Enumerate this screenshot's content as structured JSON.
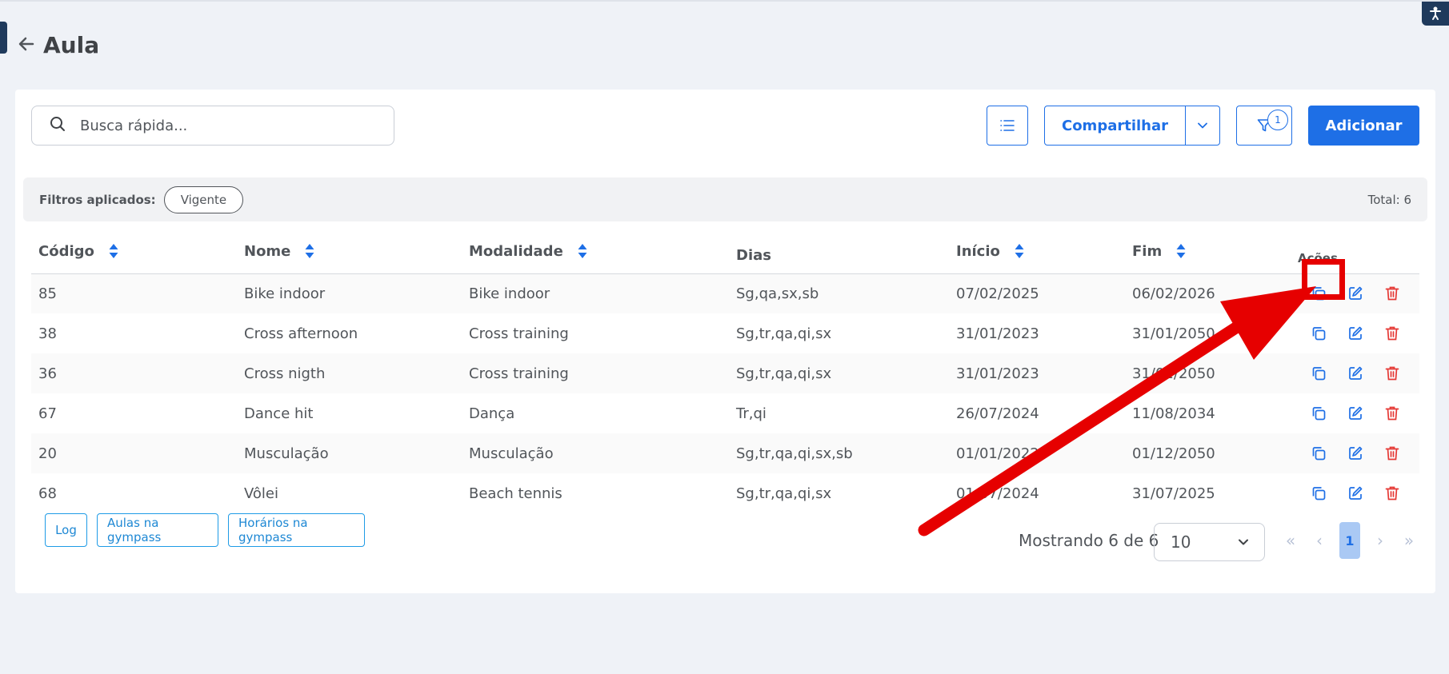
{
  "page": {
    "title": "Aula"
  },
  "search": {
    "placeholder": "Busca rápida..."
  },
  "toolbar": {
    "share_label": "Compartilhar",
    "filter_count": "1",
    "add_label": "Adicionar"
  },
  "filters": {
    "label": "Filtros aplicados:",
    "chip": "Vigente",
    "total": "Total: 6"
  },
  "table": {
    "headers": {
      "codigo": "Código",
      "nome": "Nome",
      "modalidade": "Modalidade",
      "dias": "Dias",
      "inicio": "Início",
      "fim": "Fim",
      "acoes": "Ações"
    },
    "rows": [
      {
        "codigo": "85",
        "nome": "Bike indoor",
        "modalidade": "Bike indoor",
        "dias": "Sg,qa,sx,sb",
        "inicio": "07/02/2025",
        "fim": "06/02/2026"
      },
      {
        "codigo": "38",
        "nome": "Cross afternoon",
        "modalidade": "Cross training",
        "dias": "Sg,tr,qa,qi,sx",
        "inicio": "31/01/2023",
        "fim": "31/01/2050"
      },
      {
        "codigo": "36",
        "nome": "Cross nigth",
        "modalidade": "Cross training",
        "dias": "Sg,tr,qa,qi,sx",
        "inicio": "31/01/2023",
        "fim": "31/01/2050"
      },
      {
        "codigo": "67",
        "nome": "Dance hit",
        "modalidade": "Dança",
        "dias": "Tr,qi",
        "inicio": "26/07/2024",
        "fim": "11/08/2034"
      },
      {
        "codigo": "20",
        "nome": "Musculação",
        "modalidade": "Musculação",
        "dias": "Sg,tr,qa,qi,sx,sb",
        "inicio": "01/01/2022",
        "fim": "01/12/2050"
      },
      {
        "codigo": "68",
        "nome": "Vôlei",
        "modalidade": "Beach tennis",
        "dias": "Sg,tr,qa,qi,sx",
        "inicio": "01/07/2024",
        "fim": "31/07/2025"
      }
    ]
  },
  "footer": {
    "log_label": "Log",
    "aulas_gympass_label": "Aulas na gympass",
    "horarios_gympass_label": "Horários na gympass",
    "showing": "Mostrando 6 de 6",
    "page_size": "10",
    "current_page": "1"
  },
  "colors": {
    "accent": "#1e6fe6",
    "danger": "#e53935",
    "annotation": "#e60000"
  }
}
